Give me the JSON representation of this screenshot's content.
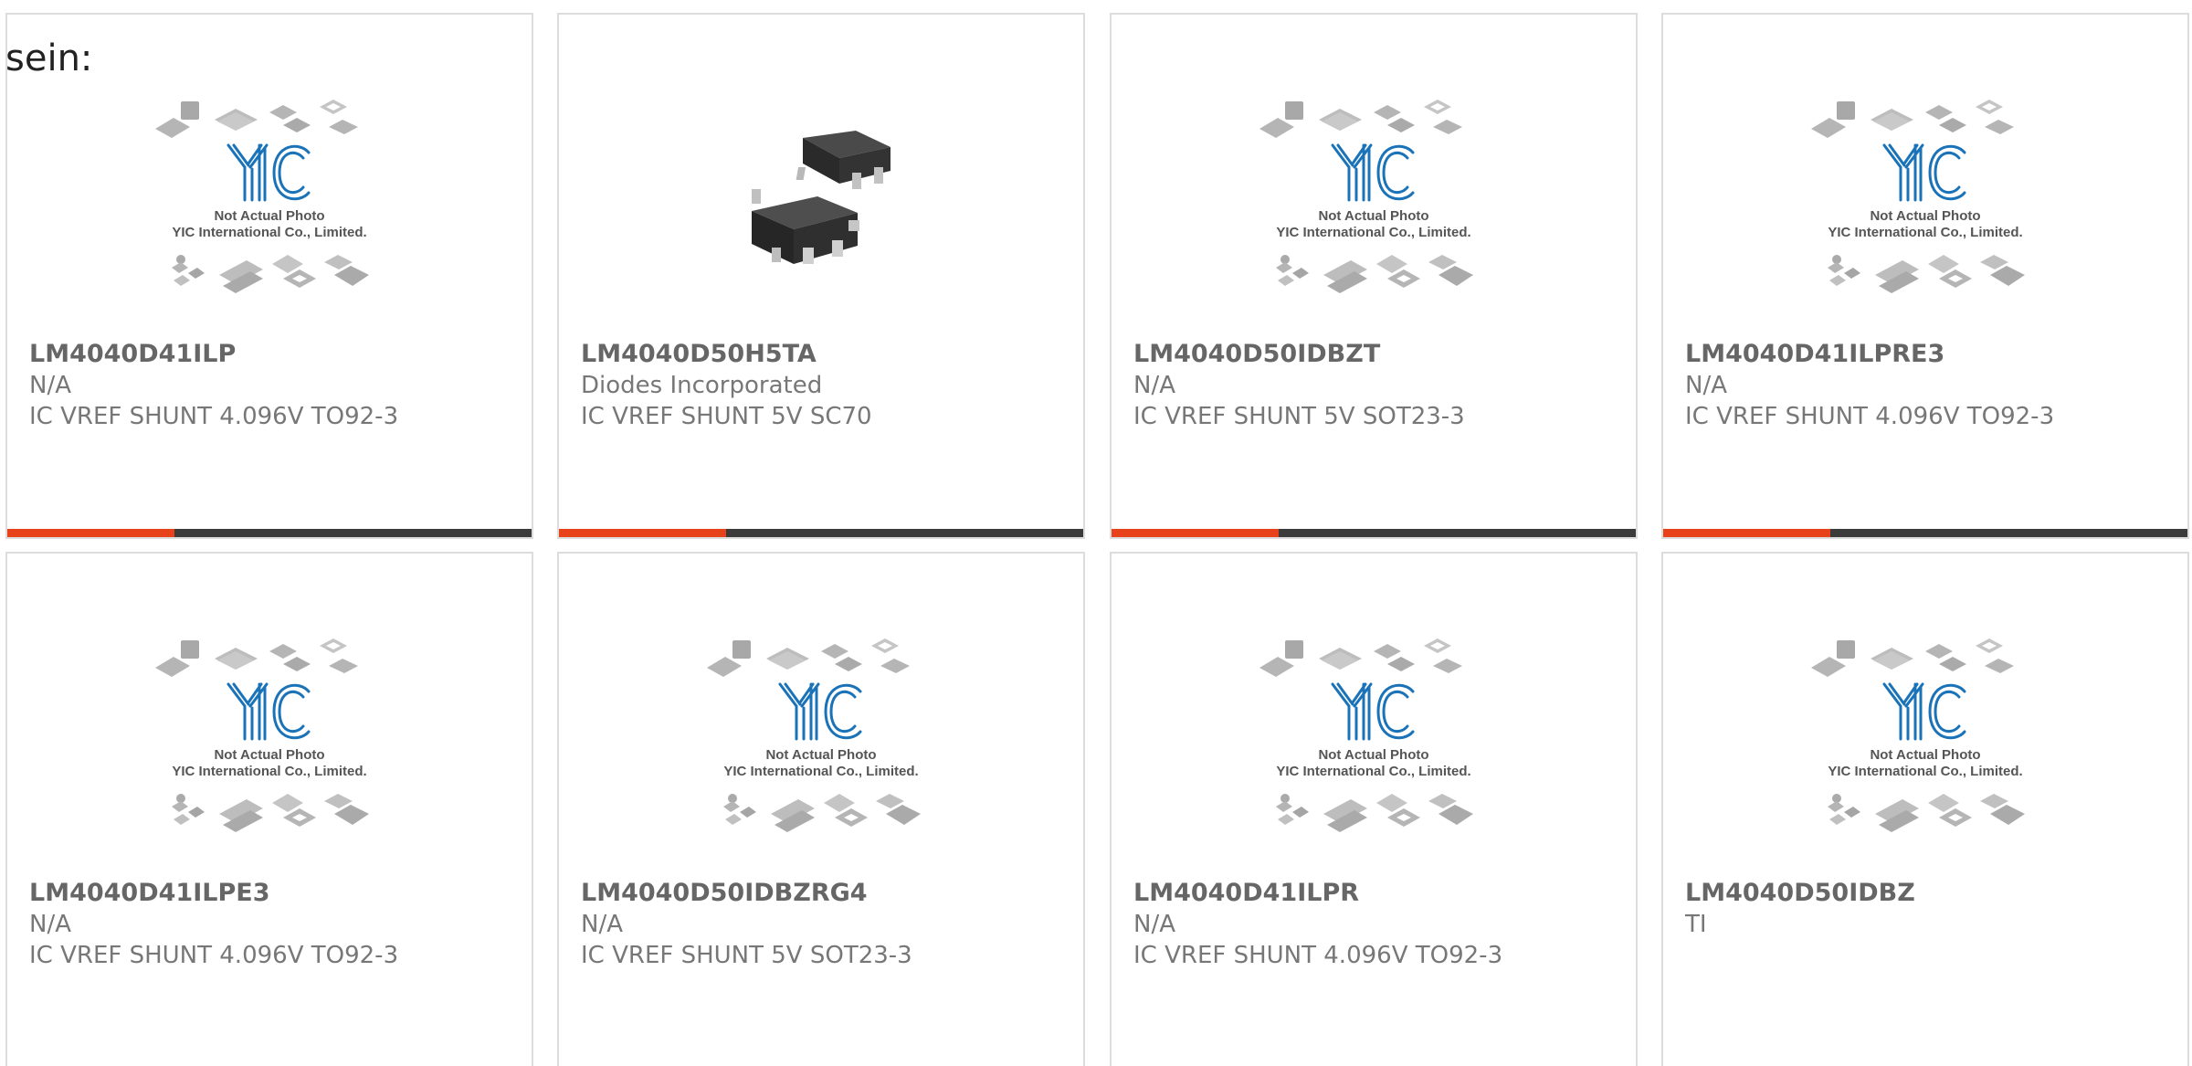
{
  "intro_text": "sein:",
  "colors": {
    "accent": "#e8421a",
    "bar": "#3b3b3b",
    "logo_blue": "#1a73b8",
    "text_gray": "#777777"
  },
  "placeholder": {
    "line1": "Not Actual Photo",
    "line2": "YIC International Co., Limited.",
    "logo": "YIC"
  },
  "products": [
    {
      "part": "LM4040D41ILP",
      "manufacturer": "N/A",
      "description": "IC VREF SHUNT 4.096V TO92-3",
      "image": "placeholder"
    },
    {
      "part": "LM4040D50H5TA",
      "manufacturer": "Diodes Incorporated",
      "description": "IC VREF SHUNT 5V SC70",
      "image": "photo-sc70"
    },
    {
      "part": "LM4040D50IDBZT",
      "manufacturer": "N/A",
      "description": "IC VREF SHUNT 5V SOT23-3",
      "image": "placeholder"
    },
    {
      "part": "LM4040D41ILPRE3",
      "manufacturer": "N/A",
      "description": "IC VREF SHUNT 4.096V TO92-3",
      "image": "placeholder"
    },
    {
      "part": "LM4040D41ILPE3",
      "manufacturer": "N/A",
      "description": "IC VREF SHUNT 4.096V TO92-3",
      "image": "placeholder"
    },
    {
      "part": "LM4040D50IDBZRG4",
      "manufacturer": "N/A",
      "description": "IC VREF SHUNT 5V SOT23-3",
      "image": "placeholder"
    },
    {
      "part": "LM4040D41ILPR",
      "manufacturer": "N/A",
      "description": "IC VREF SHUNT 4.096V TO92-3",
      "image": "placeholder"
    },
    {
      "part": "LM4040D50IDBZ",
      "manufacturer": "TI",
      "description": "",
      "image": "placeholder"
    }
  ]
}
